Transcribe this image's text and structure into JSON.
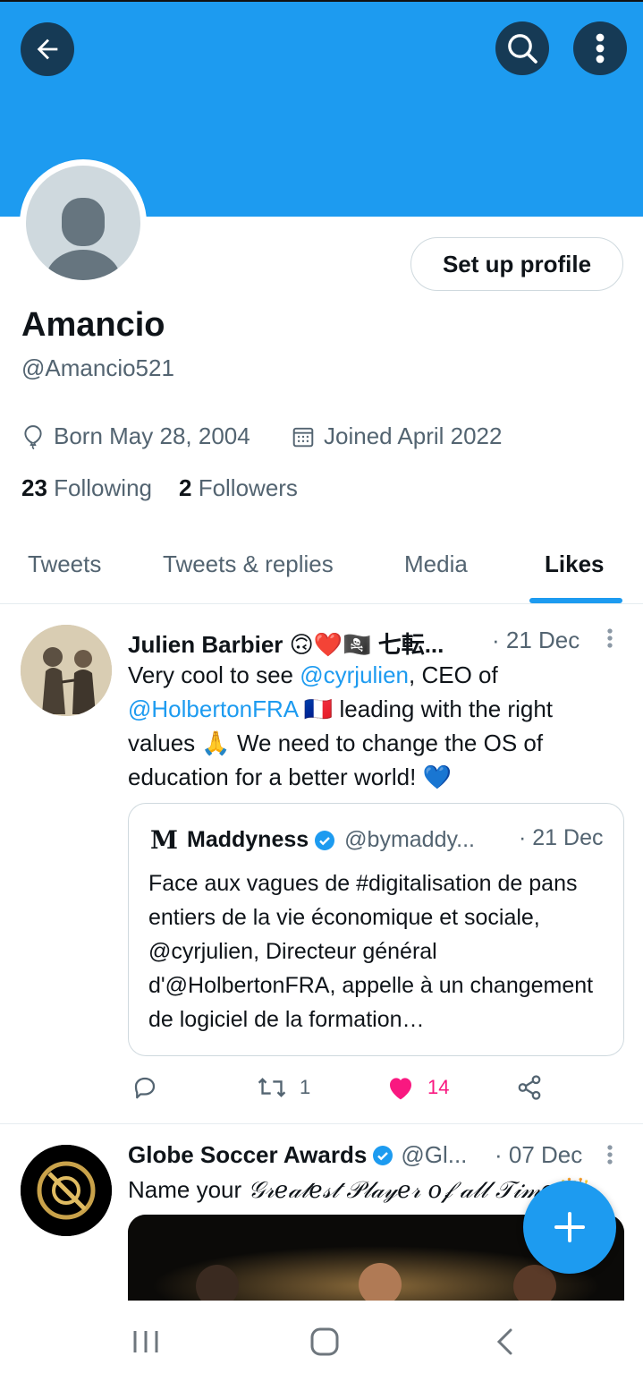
{
  "header": {
    "back_icon": "arrow-left-icon",
    "search_icon": "search-icon",
    "more_icon": "more-vertical-icon",
    "banner_color": "#1d9bf0"
  },
  "profile": {
    "setup_label": "Set up profile",
    "name": "Amancio",
    "handle": "@Amancio521",
    "born": "Born May 28, 2004",
    "joined": "Joined April 2022",
    "following_count": "23",
    "following_label": "Following",
    "followers_count": "2",
    "followers_label": "Followers"
  },
  "tabs": [
    {
      "label": "Tweets"
    },
    {
      "label": "Tweets & replies"
    },
    {
      "label": "Media"
    },
    {
      "label": "Likes",
      "active": true
    }
  ],
  "tweets": [
    {
      "name": "Julien Barbier 🙃❤️🏴‍☠️ 七転...",
      "date": "· 21 Dec",
      "text": {
        "p1": "Very cool to see ",
        "m1": "@cyrjulien",
        "p2": ", CEO of ",
        "m2": "@HolbertonFRA",
        "p3": " 🇫🇷 leading with the right values 🙏 We need to change the OS of education for a better world! 💙"
      },
      "quote": {
        "name": "Maddyness",
        "handle": "@bymaddy...",
        "date": "· 21 Dec",
        "text": "Face aux vagues de #digitalisation de pans entiers de la vie économique et sociale, @cyrjulien, Directeur général d'@HolbertonFRA, appelle à un changement de logiciel de la formation…"
      },
      "retweets": "1",
      "likes": "14",
      "liked": true
    },
    {
      "name": "Globe Soccer Awards",
      "handle": "@Gl...",
      "date": "· 07 Dec",
      "text_plain": "Name your ",
      "text_styled": "𝒢𝓇𝑒𝒶𝓉𝑒𝓈𝓉 𝒫𝓁𝒶𝓎𝑒𝓇 𝑜𝒻 𝒶𝓁𝓁 𝒯𝒾𝓂𝑒",
      "text_emoji": "👑"
    }
  ],
  "fab_icon": "plus-icon",
  "navbar": {
    "recents_icon": "recent-apps-icon",
    "home_icon": "home-icon",
    "back_icon": "nav-back-icon"
  },
  "colors": {
    "accent": "#1d9bf0",
    "like": "#f91880",
    "text_secondary": "#536471"
  }
}
